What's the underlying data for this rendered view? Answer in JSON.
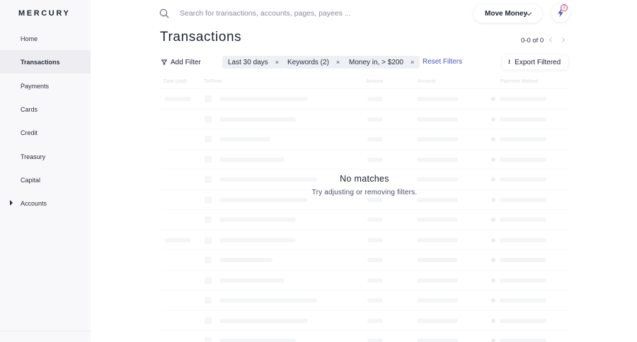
{
  "brand": "MERCURY",
  "sidebar": {
    "items": [
      {
        "label": "Home"
      },
      {
        "label": "Transactions"
      },
      {
        "label": "Payments"
      },
      {
        "label": "Cards"
      },
      {
        "label": "Credit"
      },
      {
        "label": "Treasury"
      },
      {
        "label": "Capital"
      },
      {
        "label": "Accounts"
      }
    ],
    "active": "Transactions"
  },
  "search": {
    "placeholder": "Search for transactions, accounts, pages, payees ..."
  },
  "header": {
    "move_money_label": "Move Money",
    "notification_count": "2"
  },
  "page": {
    "title": "Transactions",
    "pagination": "0-0 of 0"
  },
  "filters": {
    "add_filter_label": "Add Filter",
    "chips": [
      {
        "label": "Last 30 days"
      },
      {
        "label": "Keywords (2)"
      },
      {
        "label": "Money in, > $200"
      }
    ],
    "chip_close": "×",
    "reset_label": "Reset Filters",
    "export_label": "Export Filtered"
  },
  "table": {
    "columns": [
      "Date (ddd)",
      "To/From",
      "Amount",
      "Account",
      "Payment Method"
    ]
  },
  "empty_state": {
    "title": "No matches",
    "subtitle": "Try adjusting or removing filters."
  },
  "colors": {
    "accent": "#4a55c7",
    "badge": "#d23b5c"
  },
  "icons": {
    "search": "search-icon",
    "filter": "filter-icon",
    "export": "download-icon",
    "notifications": "lightning-icon"
  }
}
